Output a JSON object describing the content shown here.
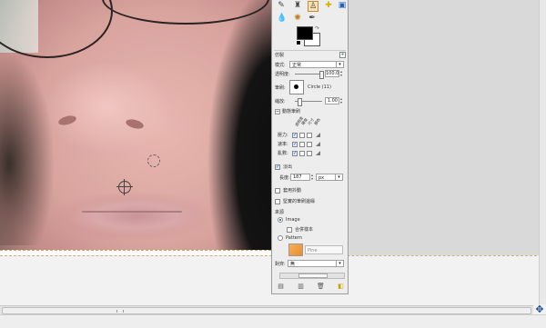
{
  "tool_options": {
    "tool_icons": [
      "pencil-icon",
      "bucket-fill-icon",
      "clone-stamp-icon",
      "heal-icon",
      "perspective-clone-icon",
      "smudge-icon",
      "blur-icon",
      "dodge-burn-icon"
    ],
    "mode": {
      "label": "模式:",
      "value": "正常"
    },
    "opacity": {
      "label": "透明度:",
      "value": "100.0",
      "fraction": 1.0
    },
    "brush": {
      "label": "筆刷:",
      "name": "Circle (11)"
    },
    "scale": {
      "label": "縮放:",
      "value": "1.00",
      "fraction": 0.1
    },
    "brush_dynamics": {
      "label": "動態筆刷",
      "column_headers": [
        "透明度",
        "硬度",
        "尺寸",
        "顏色"
      ],
      "rows": [
        {
          "label": "壓力:",
          "checks": [
            true,
            false,
            false
          ]
        },
        {
          "label": "速率:",
          "checks": [
            true,
            false,
            false
          ]
        },
        {
          "label": "亂數:",
          "checks": [
            true,
            false,
            false
          ]
        }
      ]
    },
    "fade_out": {
      "label": "淡出",
      "checked": true,
      "length_label": "長度:",
      "length_value": "187",
      "unit": "px"
    },
    "apply_jitter": {
      "label": "套用抖動",
      "checked": false
    },
    "hard_edge": {
      "label": "堅實的筆刷邊緣",
      "checked": false
    },
    "source": {
      "label": "來源",
      "options": [
        {
          "label": "Image",
          "selected": true
        },
        {
          "label": "Pattern",
          "selected": false
        }
      ],
      "sample_merged": {
        "label": "合併樣本",
        "checked": false
      },
      "pattern_name": "Pine"
    },
    "alignment": {
      "label": "對齊:",
      "value": "無"
    }
  },
  "colors": {
    "foreground": "#000000",
    "background": "#ffffff"
  },
  "status": {
    "nav_icon": "navigate-icon"
  }
}
